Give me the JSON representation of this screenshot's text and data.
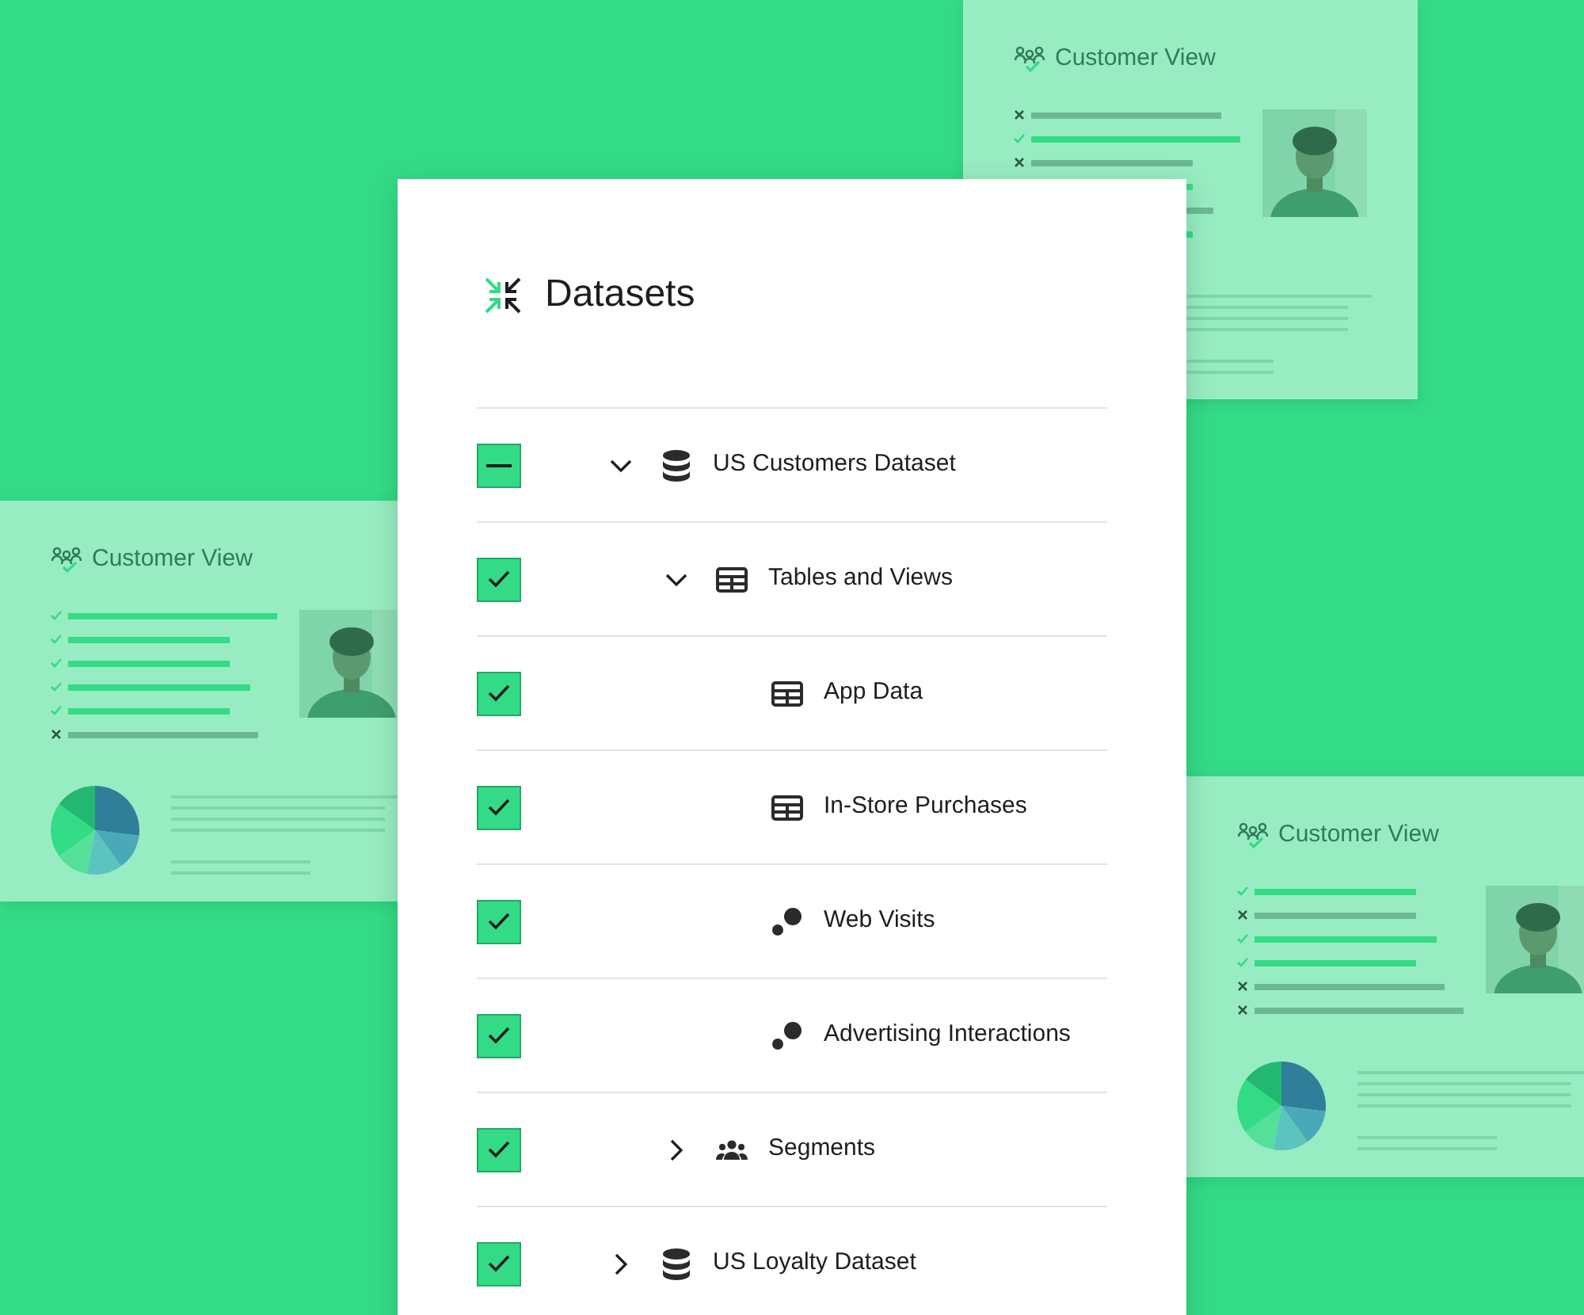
{
  "cards": [
    {
      "title": "Customer View",
      "rows": [
        {
          "checked": false
        },
        {
          "checked": true
        },
        {
          "checked": false
        },
        {
          "checked": true
        },
        {
          "checked": false
        },
        {
          "checked": true
        }
      ]
    },
    {
      "title": "Customer View",
      "rows": [
        {
          "checked": true
        },
        {
          "checked": true
        },
        {
          "checked": true
        },
        {
          "checked": true
        },
        {
          "checked": true
        },
        {
          "checked": false
        }
      ]
    },
    {
      "title": "Customer View",
      "rows": [
        {
          "checked": true
        },
        {
          "checked": false
        },
        {
          "checked": true
        },
        {
          "checked": true
        },
        {
          "checked": false
        },
        {
          "checked": false
        }
      ]
    }
  ],
  "panel": {
    "title": "Datasets",
    "tree": [
      {
        "label": "US Customers Dataset",
        "kind": "database",
        "checked": true,
        "partial": true,
        "expanded": true,
        "children": [
          {
            "label": "Tables and Views",
            "kind": "table",
            "checked": true,
            "partial": false,
            "expanded": true,
            "children": [
              {
                "label": "App Data",
                "kind": "table",
                "checked": true,
                "partial": false
              },
              {
                "label": "In-Store Purchases",
                "kind": "table",
                "checked": true,
                "partial": false
              },
              {
                "label": "Web Visits",
                "kind": "events",
                "checked": true,
                "partial": false
              },
              {
                "label": "Advertising Interactions",
                "kind": "events",
                "checked": true,
                "partial": false
              }
            ]
          },
          {
            "label": "Segments",
            "kind": "segments",
            "checked": true,
            "partial": false,
            "expanded": false
          }
        ]
      },
      {
        "label": "US Loyalty Dataset",
        "kind": "database",
        "checked": true,
        "partial": false,
        "expanded": false
      }
    ]
  }
}
